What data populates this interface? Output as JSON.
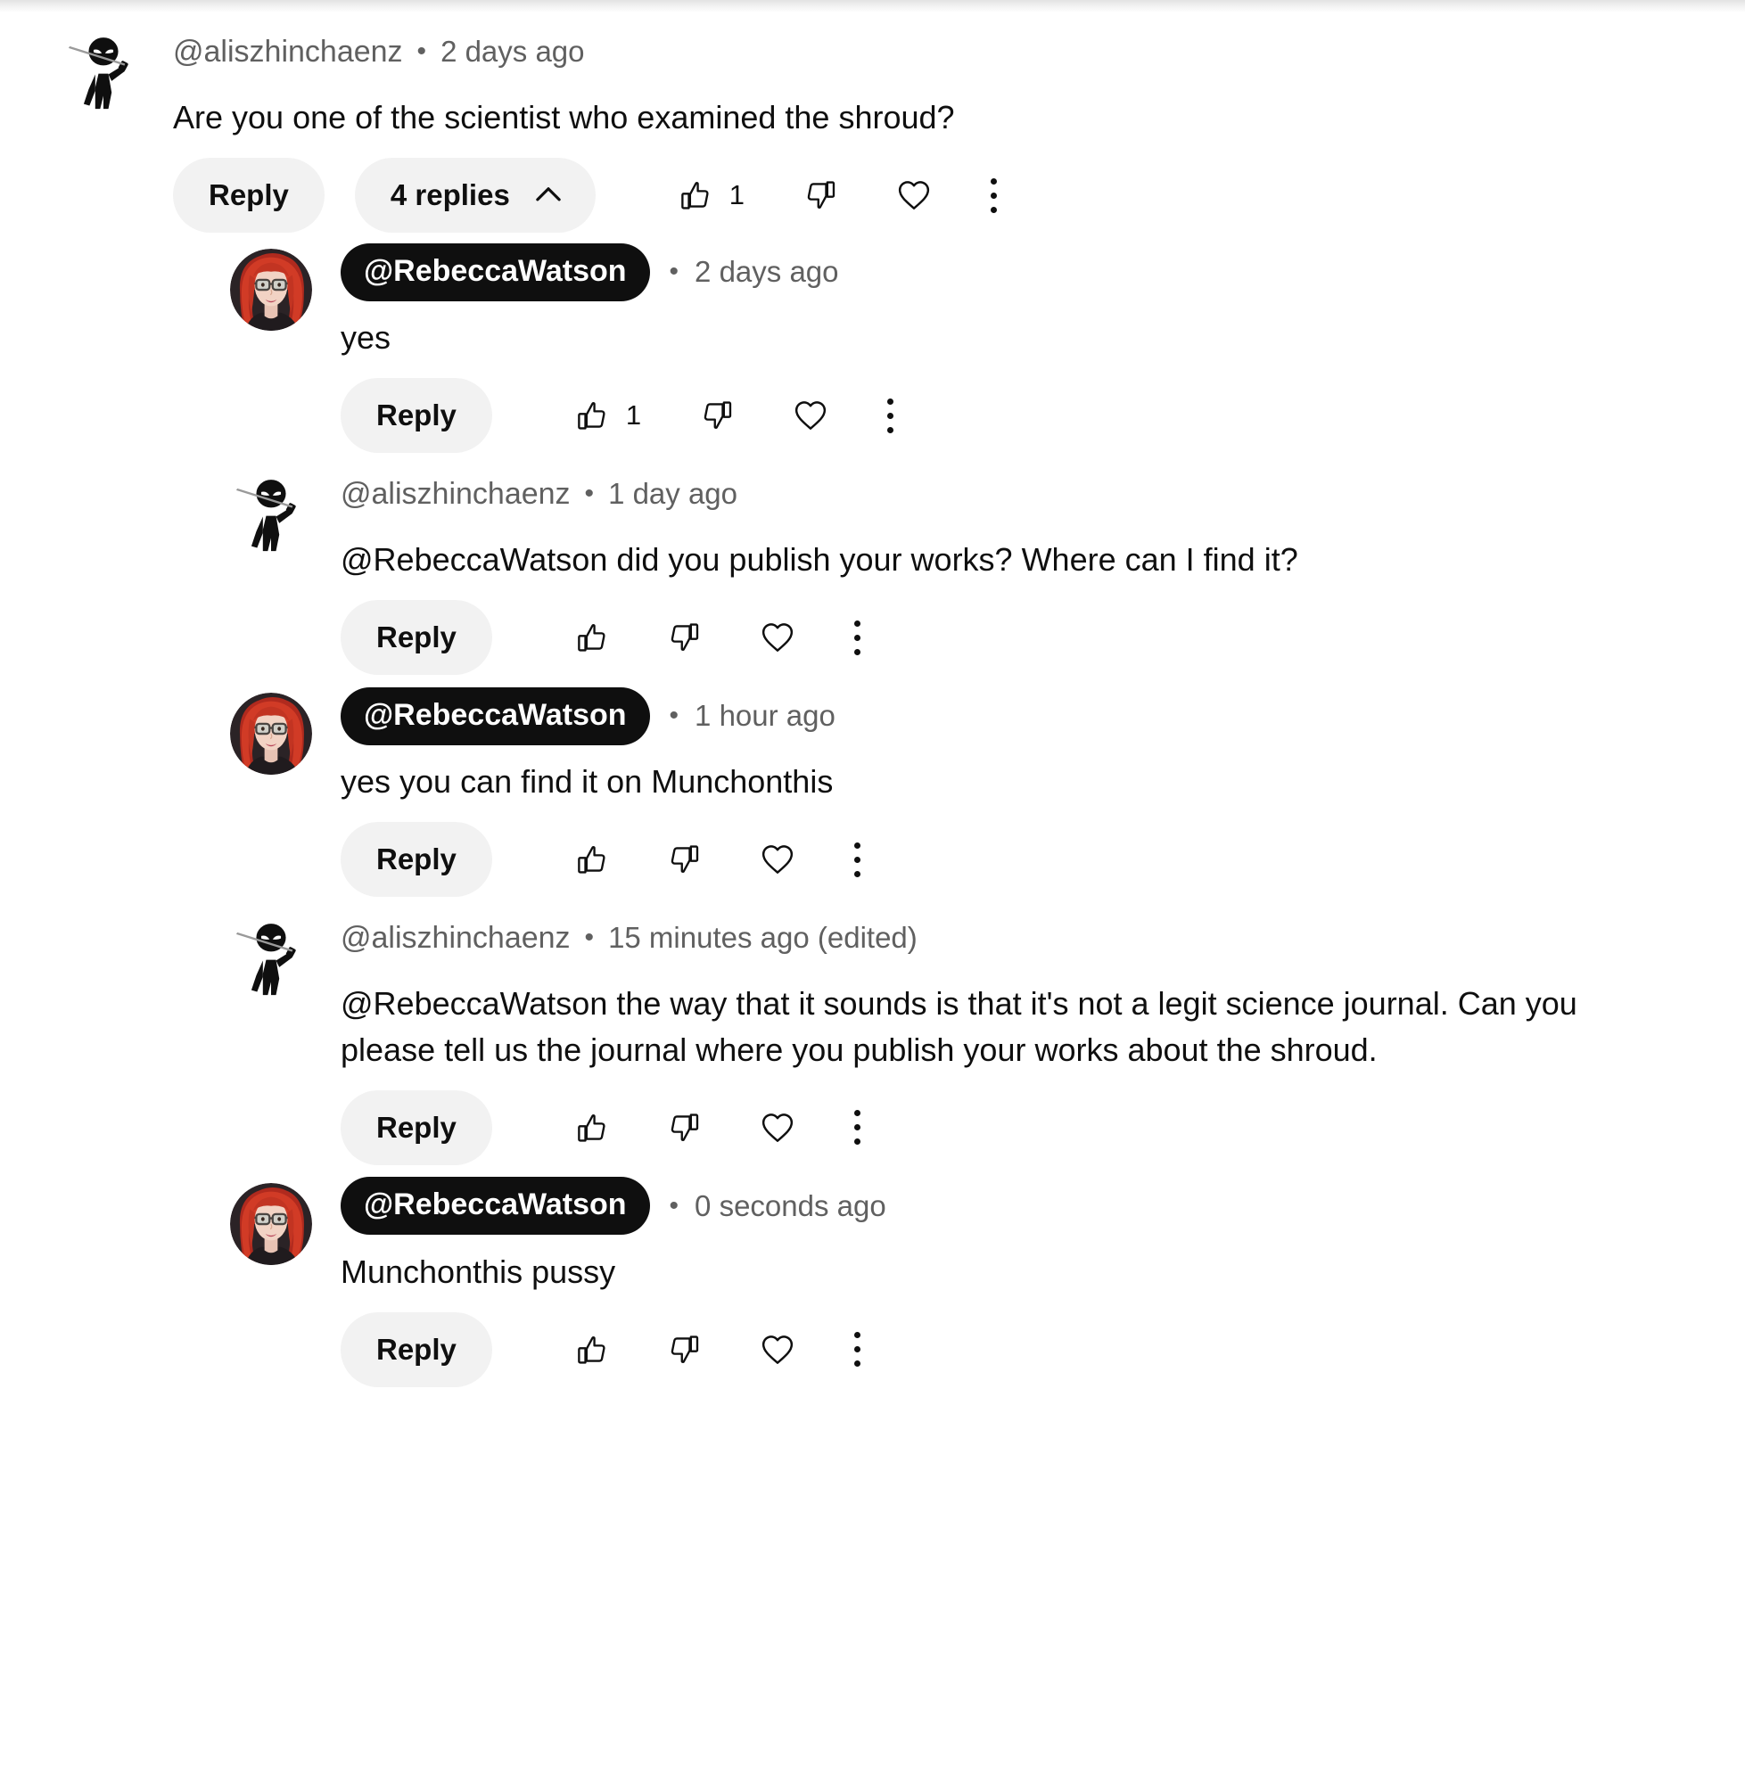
{
  "theme": {
    "background": "#ffffff",
    "text_primary": "#0f0f0f",
    "text_secondary": "#606060",
    "pill_background": "#f2f2f2",
    "owner_badge_background": "#0f0f0f",
    "owner_badge_text": "#ffffff"
  },
  "icons": {
    "like": "thumbs-up-icon",
    "dislike": "thumbs-down-icon",
    "heart": "heart-icon",
    "more": "more-vertical-icon",
    "collapse": "chevron-up-icon"
  },
  "labels": {
    "reply": "Reply"
  },
  "thread": {
    "root": {
      "author": "@aliszhinchaenz",
      "separator": "•",
      "time": "2 days ago",
      "avatar": "ninja-stick-figure-avatar",
      "text": "Are you one of the scientist who examined the shroud?",
      "is_owner": false,
      "reply_label": "Reply",
      "replies_toggle_label": "4 replies",
      "replies_expanded": true,
      "like_count": "1",
      "dislike_count": "",
      "heart_active": false
    },
    "replies": [
      {
        "author": "@RebeccaWatson",
        "separator": "•",
        "time": "2 days ago",
        "avatar": "rebecca-watson-avatar",
        "text": "yes",
        "is_owner": true,
        "reply_label": "Reply",
        "like_count": "1",
        "dislike_count": "",
        "heart_active": false
      },
      {
        "author": "@aliszhinchaenz",
        "separator": "•",
        "time": "1 day ago",
        "avatar": "ninja-stick-figure-avatar",
        "text": "@RebeccaWatson did you publish your works? Where can I find it?",
        "is_owner": false,
        "reply_label": "Reply",
        "like_count": "",
        "dislike_count": "",
        "heart_active": false
      },
      {
        "author": "@RebeccaWatson",
        "separator": "•",
        "time": "1 hour ago",
        "avatar": "rebecca-watson-avatar",
        "text": "yes you can find it on Munchonthis",
        "is_owner": true,
        "reply_label": "Reply",
        "like_count": "",
        "dislike_count": "",
        "heart_active": false
      },
      {
        "author": "@aliszhinchaenz",
        "separator": "•",
        "time": "15 minutes ago (edited)",
        "avatar": "ninja-stick-figure-avatar",
        "text": "@RebeccaWatson the way that it sounds is that it's not a legit science journal. Can you please tell us the journal where you publish your works about the shroud.",
        "is_owner": false,
        "reply_label": "Reply",
        "like_count": "",
        "dislike_count": "",
        "heart_active": false
      },
      {
        "author": "@RebeccaWatson",
        "separator": "•",
        "time": "0 seconds ago",
        "avatar": "rebecca-watson-avatar",
        "text": "Munchonthis pussy",
        "is_owner": true,
        "reply_label": "Reply",
        "like_count": "",
        "dislike_count": "",
        "heart_active": false
      }
    ]
  }
}
